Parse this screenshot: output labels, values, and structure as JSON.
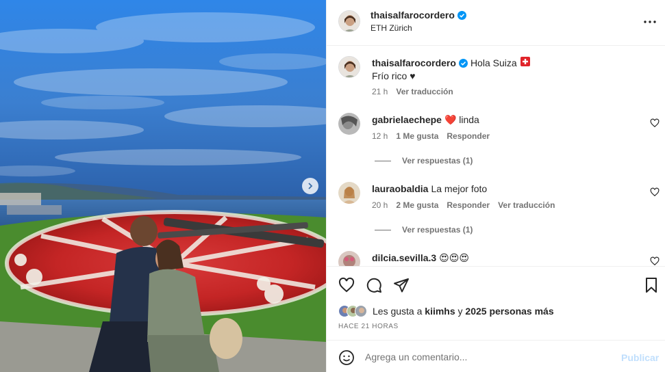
{
  "post": {
    "author": "thaisalfarocordero",
    "verified": true,
    "location": "ETH Zürich",
    "more_icon": "more-horizontal-icon"
  },
  "caption": {
    "author": "thaisalfarocordero",
    "text": "Hola Suiza",
    "flag": "🇨🇭",
    "line2": "Frío rico ♥",
    "time": "21 h",
    "translate": "Ver traducción"
  },
  "comments": [
    {
      "user": "gabrielaechepe",
      "text": "❤️ linda",
      "time": "12 h",
      "likes": "1 Me gusta",
      "reply": "Responder",
      "view_replies": "Ver respuestas (1)"
    },
    {
      "user": "lauraobaldia",
      "text": "La mejor foto",
      "time": "20 h",
      "likes": "2 Me gusta",
      "reply": "Responder",
      "translate": "Ver traducción",
      "view_replies": "Ver respuestas (1)"
    },
    {
      "user": "dilcia.sevilla.3",
      "text": "😍😍😍"
    }
  ],
  "likes": {
    "prefix": "Les gusta a",
    "first_user": "kiimhs",
    "joiner": "y",
    "others": "2025 personas más"
  },
  "time_ago": "HACE 21 HORAS",
  "add_comment": {
    "placeholder": "Agrega un comentario...",
    "publish": "Publicar"
  },
  "colors": {
    "verified_blue": "#0095f6",
    "link_disabled": "#c0dffd",
    "muted_text": "#737373"
  }
}
